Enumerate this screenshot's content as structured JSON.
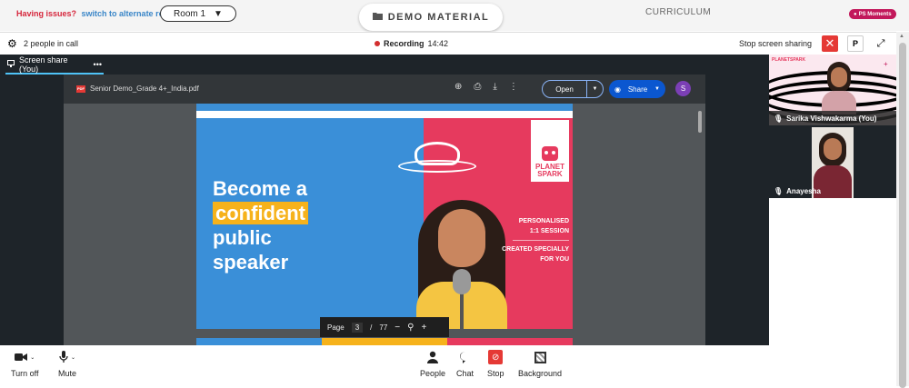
{
  "topbar": {
    "issues_text": "Having issues?",
    "alternate_link": "switch to alternate room",
    "room_label": "Room 1",
    "demo_material": "DEMO MATERIAL",
    "curriculum": "CURRICULUM",
    "ps_moments": "PS Moments"
  },
  "call": {
    "people_count": "2 people in call",
    "recording_label": "Recording",
    "recording_time": "14:42",
    "stop_sharing": "Stop screen sharing",
    "p_button": "P"
  },
  "screenshare": {
    "tab_label": "Screen share (You)",
    "tab_more": "•••"
  },
  "pdf": {
    "icon_text": "PDF",
    "filename": "Senior Demo_Grade 4+_India.pdf",
    "open_label": "Open",
    "share_label": "Share",
    "avatar_letter": "S",
    "page_label": "Page",
    "page_current": "3",
    "page_sep": "/",
    "page_total": "77"
  },
  "slide": {
    "line1": "Become a",
    "line2": "confident",
    "line3": "public",
    "line4": "speaker",
    "logo_line1": "PLANET",
    "logo_line2": "SPARK",
    "personalised_line1": "PERSONALISED",
    "personalised_line2": "1:1 SESSION",
    "created_line1": "CREATED SPECIALLY",
    "created_line2": "FOR YOU",
    "colors": {
      "blue": "#3a8fd8",
      "pink": "#e63a5e",
      "yellow": "#f6b21b"
    }
  },
  "participants": {
    "tile1_brand": "PLANETSPARK",
    "p1_name": "Sarika Vishwakarma (You)",
    "p2_name": "Anayesha"
  },
  "controls": {
    "turn_off": "Turn off",
    "mute": "Mute",
    "people": "People",
    "chat": "Chat",
    "stop": "Stop",
    "background": "Background"
  }
}
